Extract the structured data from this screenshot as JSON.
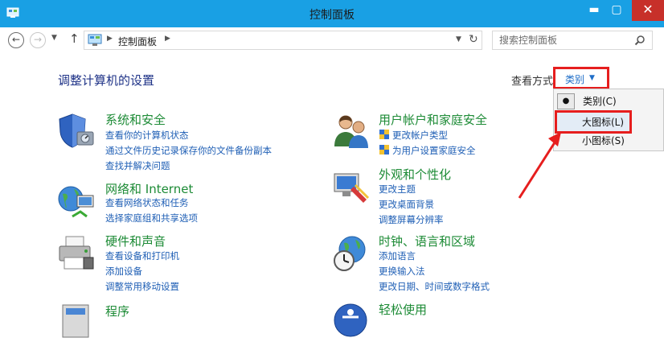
{
  "window": {
    "title": "控制面板"
  },
  "address": {
    "path": "控制面板",
    "search_placeholder": "搜索控制面板"
  },
  "page": {
    "title": "调整计算机的设置"
  },
  "viewby": {
    "label": "查看方式:",
    "value": "类别",
    "options": [
      "类别(C)",
      "大图标(L)",
      "小图标(S)"
    ]
  },
  "categories": {
    "system": {
      "title": "系统和安全",
      "links": [
        "查看你的计算机状态",
        "通过文件历史记录保存你的文件备份副本",
        "查找并解决问题"
      ]
    },
    "network": {
      "title": "网络和 Internet",
      "links": [
        "查看网络状态和任务",
        "选择家庭组和共享选项"
      ]
    },
    "hardware": {
      "title": "硬件和声音",
      "links": [
        "查看设备和打印机",
        "添加设备",
        "调整常用移动设置"
      ]
    },
    "programs": {
      "title": "程序"
    },
    "users": {
      "title": "用户帐户和家庭安全",
      "links": [
        "更改帐户类型",
        "为用户设置家庭安全"
      ]
    },
    "appearance": {
      "title": "外观和个性化",
      "links": [
        "更改主题",
        "更改桌面背景",
        "调整屏幕分辨率"
      ]
    },
    "clock": {
      "title": "时钟、语言和区域",
      "links": [
        "添加语言",
        "更换输入法",
        "更改日期、时间或数字格式"
      ]
    },
    "ease": {
      "title": "轻松使用"
    }
  },
  "colors": {
    "titlebar": "#19a0e4",
    "close": "#c7302a",
    "link": "#1f5fb5",
    "category": "#1d8b36",
    "highlight": "#e61e1e"
  }
}
